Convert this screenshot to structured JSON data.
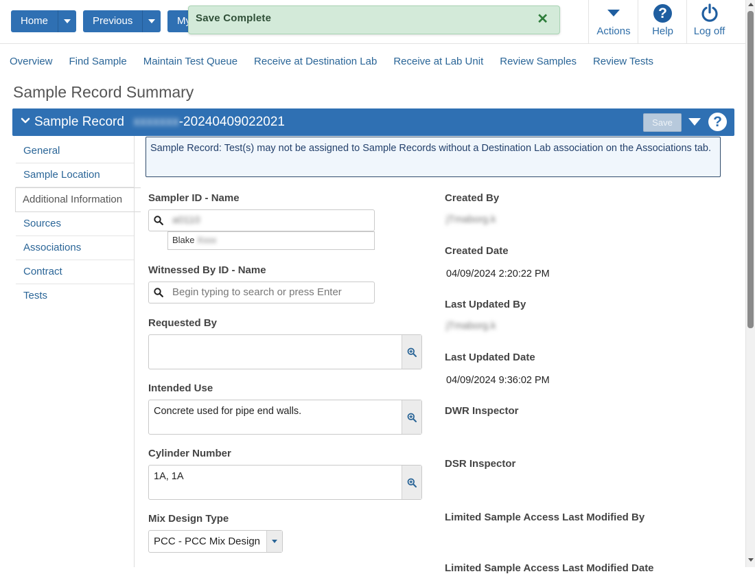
{
  "toolbar": {
    "home_label": "Home",
    "previous_label": "Previous",
    "my_label": "My",
    "actions_label": "Actions",
    "help_label": "Help",
    "logoff_label": "Log off"
  },
  "toast": {
    "message": "Save Complete",
    "close_glyph": "✕"
  },
  "nav": {
    "links": [
      "Overview",
      "Find Sample",
      "Maintain Test Queue",
      "Receive at Destination Lab",
      "Receive at Lab Unit",
      "Review Samples",
      "Review Tests"
    ]
  },
  "page": {
    "title": "Sample Record Summary"
  },
  "record": {
    "prefix": "Sample Record",
    "redacted_id": "xxxxxxx",
    "id_suffix": "-20240409022021",
    "save_label": "Save",
    "help_glyph": "?"
  },
  "sidebar": {
    "tabs": [
      "General",
      "Sample Location",
      "Additional Information",
      "Sources",
      "Associations",
      "Contract",
      "Tests"
    ],
    "active": "Additional Information"
  },
  "alert": {
    "text": "Sample Record: Test(s) may not be assigned to Sample Records without a Destination Lab association on the Associations tab."
  },
  "form": {
    "sampler_label": "Sampler ID - Name",
    "sampler_value": "a0110",
    "sampler_result_name": "Blake",
    "sampler_result_redacted": "Xxxx",
    "witnessed_label": "Witnessed By ID - Name",
    "witnessed_placeholder": "Begin typing to search or press Enter",
    "requested_label": "Requested By",
    "requested_value": "",
    "intended_label": "Intended Use",
    "intended_value": "Concrete used for pipe end walls.",
    "cylinder_label": "Cylinder Number",
    "cylinder_value": "1A, 1A",
    "mix_label": "Mix Design Type",
    "mix_value": "PCC - PCC Mix Design"
  },
  "details": {
    "created_by_label": "Created By",
    "created_by_value": "jTmaborg.k",
    "created_date_label": "Created Date",
    "created_date_value": "04/09/2024 2:20:22 PM",
    "updated_by_label": "Last Updated By",
    "updated_by_value": "jTmaborg.k",
    "updated_date_label": "Last Updated Date",
    "updated_date_value": "04/09/2024 9:36:02 PM",
    "dwr_label": "DWR Inspector",
    "dsr_label": "DSR Inspector",
    "limited_label": "Limited Sample Access Last Modified By",
    "limited_date_label": "Limited Sample Access Last Modified Date"
  },
  "colors": {
    "primary": "#2f70b3",
    "link": "#2a6597",
    "toast_bg": "#d3ead9",
    "alert_bg": "#f0f6fc"
  }
}
